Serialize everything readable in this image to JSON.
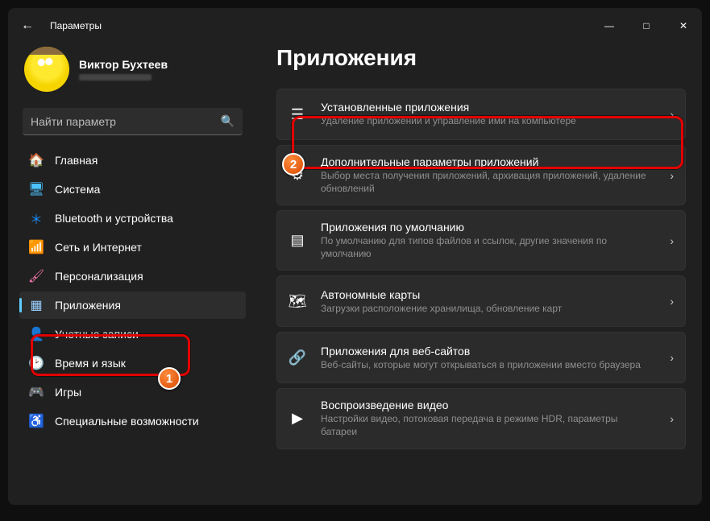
{
  "window": {
    "title": "Параметры"
  },
  "profile": {
    "name": "Виктор Бухтеев"
  },
  "search": {
    "placeholder": "Найти параметр"
  },
  "sidebar": {
    "items": [
      {
        "label": "Главная"
      },
      {
        "label": "Система"
      },
      {
        "label": "Bluetooth и устройства"
      },
      {
        "label": "Сеть и Интернет"
      },
      {
        "label": "Персонализация"
      },
      {
        "label": "Приложения"
      },
      {
        "label": "Учетные записи"
      },
      {
        "label": "Время и язык"
      },
      {
        "label": "Игры"
      },
      {
        "label": "Специальные возможности"
      }
    ]
  },
  "main": {
    "heading": "Приложения",
    "cards": [
      {
        "title": "Установленные приложения",
        "sub": "Удаление приложений и управление ими на компьютере"
      },
      {
        "title": "Дополнительные параметры приложений",
        "sub": "Выбор места получения приложений, архивация приложений, удаление обновлений"
      },
      {
        "title": "Приложения по умолчанию",
        "sub": "По умолчанию для типов файлов и ссылок, другие значения по умолчанию"
      },
      {
        "title": "Автономные карты",
        "sub": "Загрузки расположение хранилища, обновление карт"
      },
      {
        "title": "Приложения для веб-сайтов",
        "sub": "Веб-сайты, которые могут открываться в приложении вместо браузера"
      },
      {
        "title": "Воспроизведение видео",
        "sub": "Настройки видео, потоковая передача в режиме HDR, параметры батареи"
      }
    ]
  },
  "annotations": {
    "badge1": "1",
    "badge2": "2"
  }
}
